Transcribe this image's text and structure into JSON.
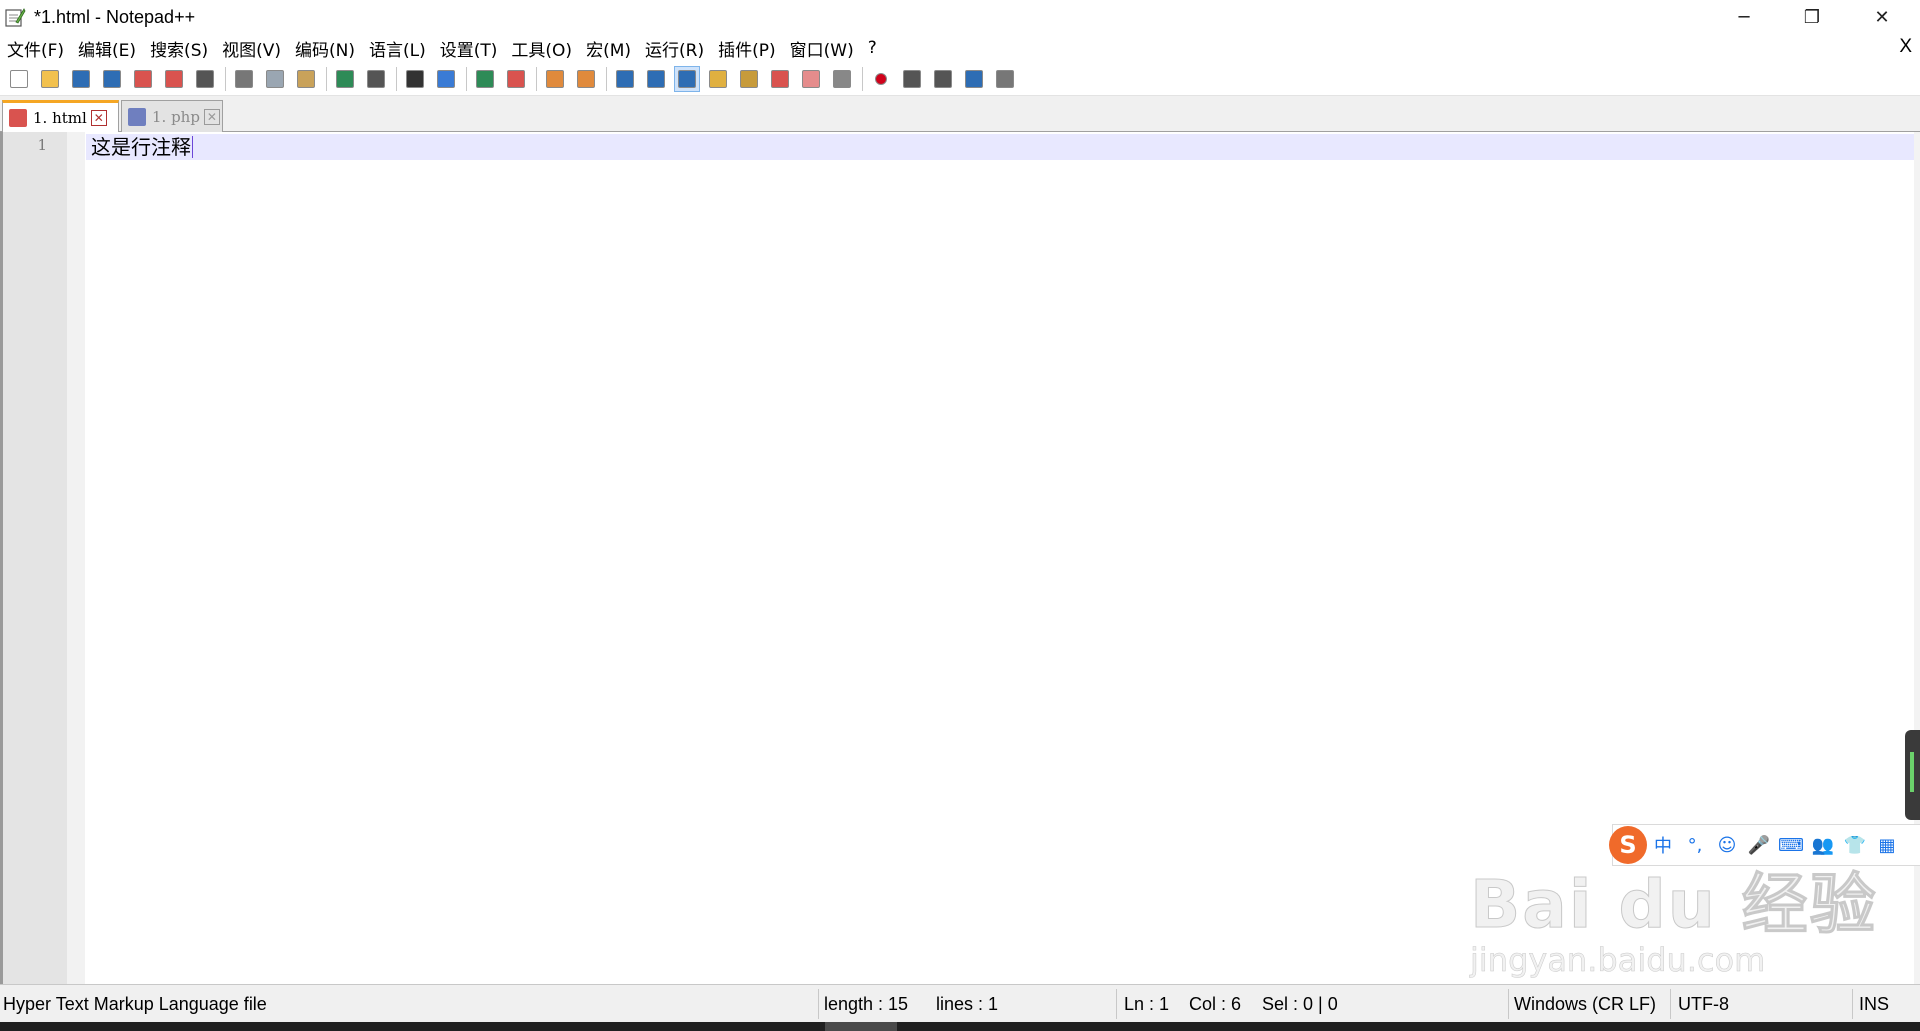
{
  "window": {
    "title": "*1.html - Notepad++",
    "controls": {
      "minimize": "─",
      "maximize": "❐",
      "close": "✕"
    }
  },
  "menubar": {
    "items": [
      "文件(F)",
      "编辑(E)",
      "搜索(S)",
      "视图(V)",
      "编码(N)",
      "语言(L)",
      "设置(T)",
      "工具(O)",
      "宏(M)",
      "运行(R)",
      "插件(P)",
      "窗口(W)",
      "?"
    ],
    "close_doc": "X"
  },
  "toolbar": {
    "icons": [
      {
        "name": "new-file-icon",
        "color": "#ffffff"
      },
      {
        "name": "open-file-icon",
        "color": "#f2c14e"
      },
      {
        "name": "save-icon",
        "color": "#2e6db4"
      },
      {
        "name": "save-all-icon",
        "color": "#2e6db4"
      },
      {
        "name": "close-icon",
        "color": "#d9534f"
      },
      {
        "name": "close-all-icon",
        "color": "#d9534f"
      },
      {
        "name": "print-icon",
        "color": "#555555"
      },
      {
        "name": "cut-icon",
        "color": "#777777"
      },
      {
        "name": "copy-icon",
        "color": "#9aa6b2"
      },
      {
        "name": "paste-icon",
        "color": "#c9a25a"
      },
      {
        "name": "undo-icon",
        "color": "#2e8b57"
      },
      {
        "name": "redo-icon",
        "color": "#555555"
      },
      {
        "name": "find-icon",
        "color": "#333333"
      },
      {
        "name": "replace-icon",
        "color": "#3a7bd5"
      },
      {
        "name": "zoom-in-icon",
        "color": "#2e8b57"
      },
      {
        "name": "zoom-out-icon",
        "color": "#d9534f"
      },
      {
        "name": "sync-vertical-icon",
        "color": "#e08a3c"
      },
      {
        "name": "sync-horizontal-icon",
        "color": "#e08a3c"
      },
      {
        "name": "word-wrap-icon",
        "color": "#2e6db4"
      },
      {
        "name": "show-all-chars-icon",
        "color": "#2e6db4"
      },
      {
        "name": "indent-guide-icon",
        "color": "#2e6db4"
      },
      {
        "name": "doc-map-icon",
        "color": "#e0b040"
      },
      {
        "name": "function-list-icon",
        "color": "#c79b3b"
      },
      {
        "name": "folder-as-workspace-icon",
        "color": "#d9534f"
      },
      {
        "name": "monitoring-icon",
        "color": "#e58c8c"
      },
      {
        "name": "eye-icon",
        "color": "#888888"
      },
      {
        "name": "record-macro-icon",
        "color": "#d0021b"
      },
      {
        "name": "stop-record-icon",
        "color": "#555555"
      },
      {
        "name": "play-macro-icon",
        "color": "#555555"
      },
      {
        "name": "run-macro-multiple-icon",
        "color": "#2e6db4"
      },
      {
        "name": "save-macro-icon",
        "color": "#777777"
      }
    ]
  },
  "tabs": [
    {
      "label": "1. html",
      "active": true,
      "icon_color": "#d9534f"
    },
    {
      "label": "1. php",
      "active": false,
      "icon_color": "#6f7fbf"
    }
  ],
  "tab_close_glyph": "✕",
  "editor": {
    "line_number": "1",
    "code": "这是行注释",
    "current_line_color": "#e8e8ff"
  },
  "ime": {
    "logo": "S",
    "buttons": [
      "中",
      "°,",
      "☺",
      "🎤",
      "⌨",
      "👥",
      "👕",
      "▦"
    ]
  },
  "watermark": {
    "line1": "Bai du 经验",
    "line2": "jingyan.baidu.com"
  },
  "statusbar": {
    "file_type": "Hyper Text Markup Language file",
    "length": "length : 15",
    "lines": "lines : 1",
    "ln": "Ln : 1",
    "col": "Col : 6",
    "sel": "Sel : 0 | 0",
    "eol": "Windows (CR LF)",
    "encoding": "UTF-8",
    "mode": "INS"
  }
}
